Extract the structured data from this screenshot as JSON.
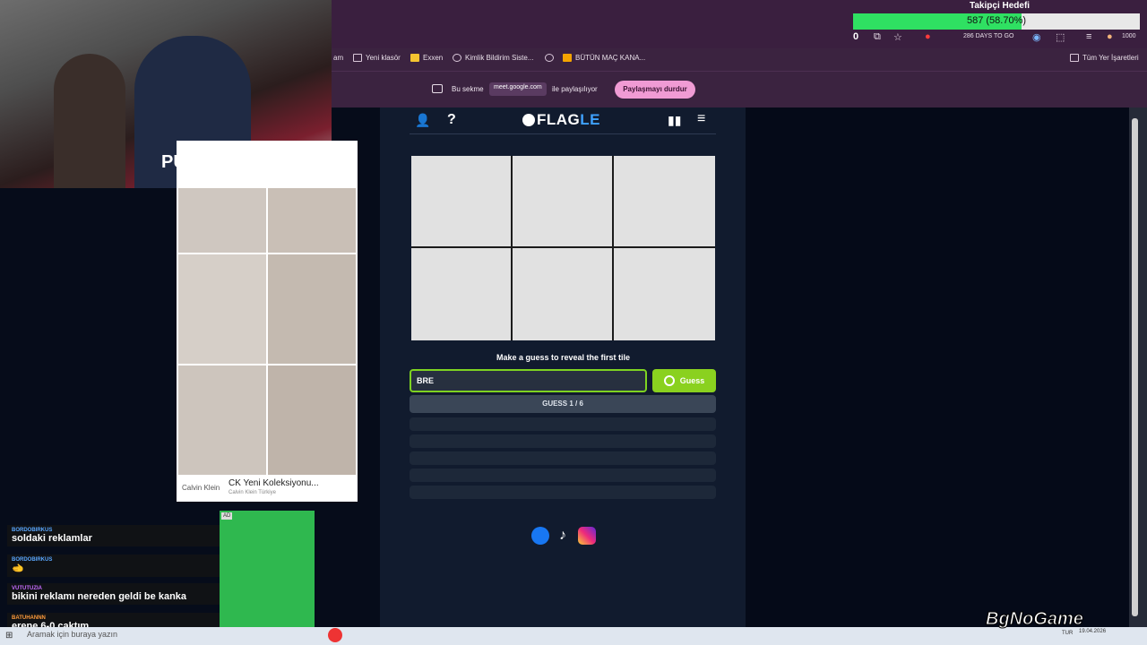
{
  "goal": {
    "title": "Takipçi Hedefi",
    "text": "587 (58.70%)",
    "progress": 0.587,
    "counter": "0"
  },
  "toolbar": {
    "days_label": "286 DAYS TO GO",
    "score": "1000"
  },
  "bookmarks": [
    "am",
    "Yeni klasör",
    "Exxen",
    "Kimlik Bildirim Siste...",
    "BÜTÜN MAÇ KANA...",
    "Tüm Yer İşaretleri"
  ],
  "share": {
    "prefix": "Bu sekme",
    "host": "meet.google.com",
    "suffix": "ile paylaşılıyor",
    "stop": "Paylaşmayı durdur"
  },
  "app": {
    "logo_a": "FLAG",
    "logo_b": "LE",
    "hint": "Make a guess to reveal the first tile",
    "input_value": "BRE",
    "guess_button": "Guess",
    "guess_counter": "GUESS 1 / 6"
  },
  "ad": {
    "brand": "Calvin Klein",
    "title": "CK Yeni Koleksiyonu...",
    "subtitle": "Calvin Klein Türkiye"
  },
  "webcam": {
    "shirt": "PUMA"
  },
  "chat": [
    {
      "user": "BORDOBIRKUS",
      "text": "soldaki reklamlar",
      "color": "#5aa7ff"
    },
    {
      "user": "BORDOBIRKUS",
      "text": "🫲",
      "color": "#5aa7ff"
    },
    {
      "user": "VUTUTUZIA",
      "text": "bikini reklamı nereden geldi be kanka",
      "color": "#c56bff"
    },
    {
      "user": "BATUHANNN",
      "text": "erene 6-0 çaktım",
      "color": "#ff9b3b"
    }
  ],
  "green_widget": {
    "ad_label": "AD"
  },
  "taskbar": {
    "search": "Aramak için buraya yazın",
    "time": "19.04.2026",
    "lang": "TUR"
  },
  "watermark": "BgNoGame"
}
